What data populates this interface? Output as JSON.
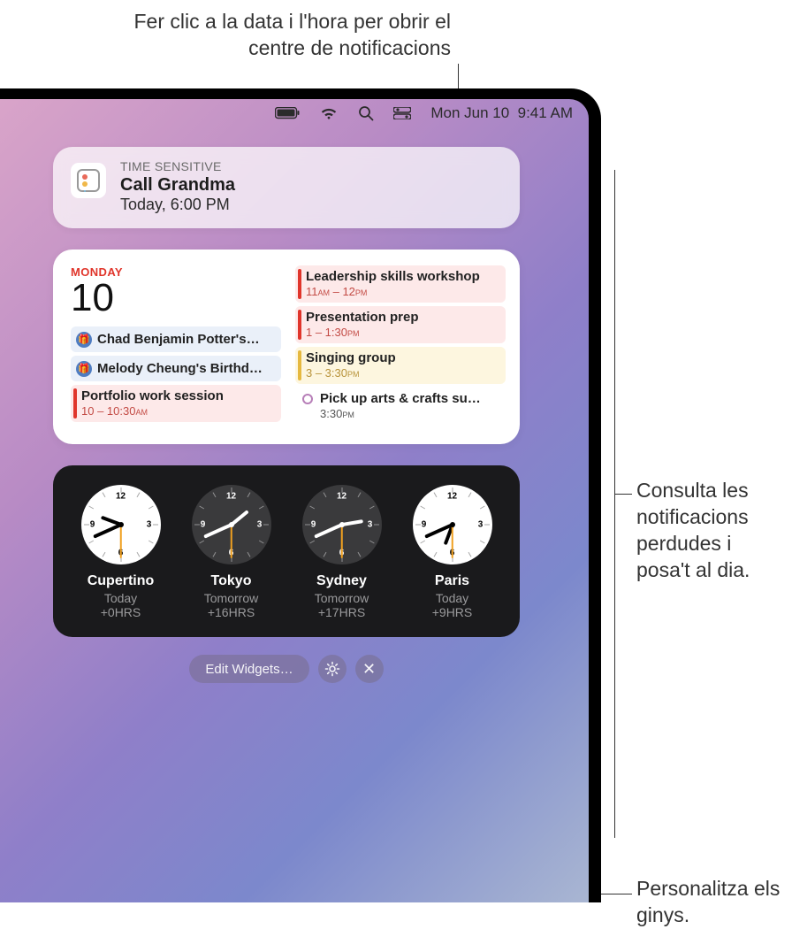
{
  "callouts": {
    "top": "Fer clic a la data i l'hora per obrir el centre de notificacions",
    "right1": "Consulta les notificacions perdudes i posa't al dia.",
    "right2": "Personalitza els ginys."
  },
  "menubar": {
    "date": "Mon Jun 10",
    "time": "9:41 AM"
  },
  "notification": {
    "tag": "time sensitive",
    "title": "Call Grandma",
    "time": "Today, 6:00 PM"
  },
  "calendar": {
    "day_label": "monday",
    "day_num": "10",
    "left_events": [
      {
        "kind": "bd",
        "title": "Chad Benjamin Potter's…"
      },
      {
        "kind": "bd",
        "title": "Melody Cheung's Birthd…"
      },
      {
        "kind": "red",
        "title": "Portfolio work session",
        "time": "10 – 10:30",
        "ampm": "am"
      }
    ],
    "right_events": [
      {
        "kind": "red",
        "title": "Leadership skills workshop",
        "time": "11",
        "ampm": "am",
        "time2": " – 12",
        "ampm2": "pm"
      },
      {
        "kind": "red",
        "title": "Presentation prep",
        "time": "1 – 1:30",
        "ampm": "pm"
      },
      {
        "kind": "yellow",
        "title": "Singing group",
        "time": "3 – 3:30",
        "ampm": "pm"
      },
      {
        "kind": "none",
        "title": "Pick up arts & crafts su…",
        "time": "3:30",
        "ampm": "pm"
      }
    ]
  },
  "clocks": [
    {
      "city": "Cupertino",
      "rel": "Today",
      "off": "+0HRS",
      "h": 9,
      "m": 41,
      "s": 30,
      "dark": false
    },
    {
      "city": "Tokyo",
      "rel": "Tomorrow",
      "off": "+16HRS",
      "h": 1,
      "m": 41,
      "s": 30,
      "dark": true
    },
    {
      "city": "Sydney",
      "rel": "Tomorrow",
      "off": "+17HRS",
      "h": 2,
      "m": 41,
      "s": 30,
      "dark": true
    },
    {
      "city": "Paris",
      "rel": "Today",
      "off": "+9HRS",
      "h": 6,
      "m": 41,
      "s": 30,
      "dark": false
    }
  ],
  "edit": {
    "label": "Edit Widgets…"
  }
}
